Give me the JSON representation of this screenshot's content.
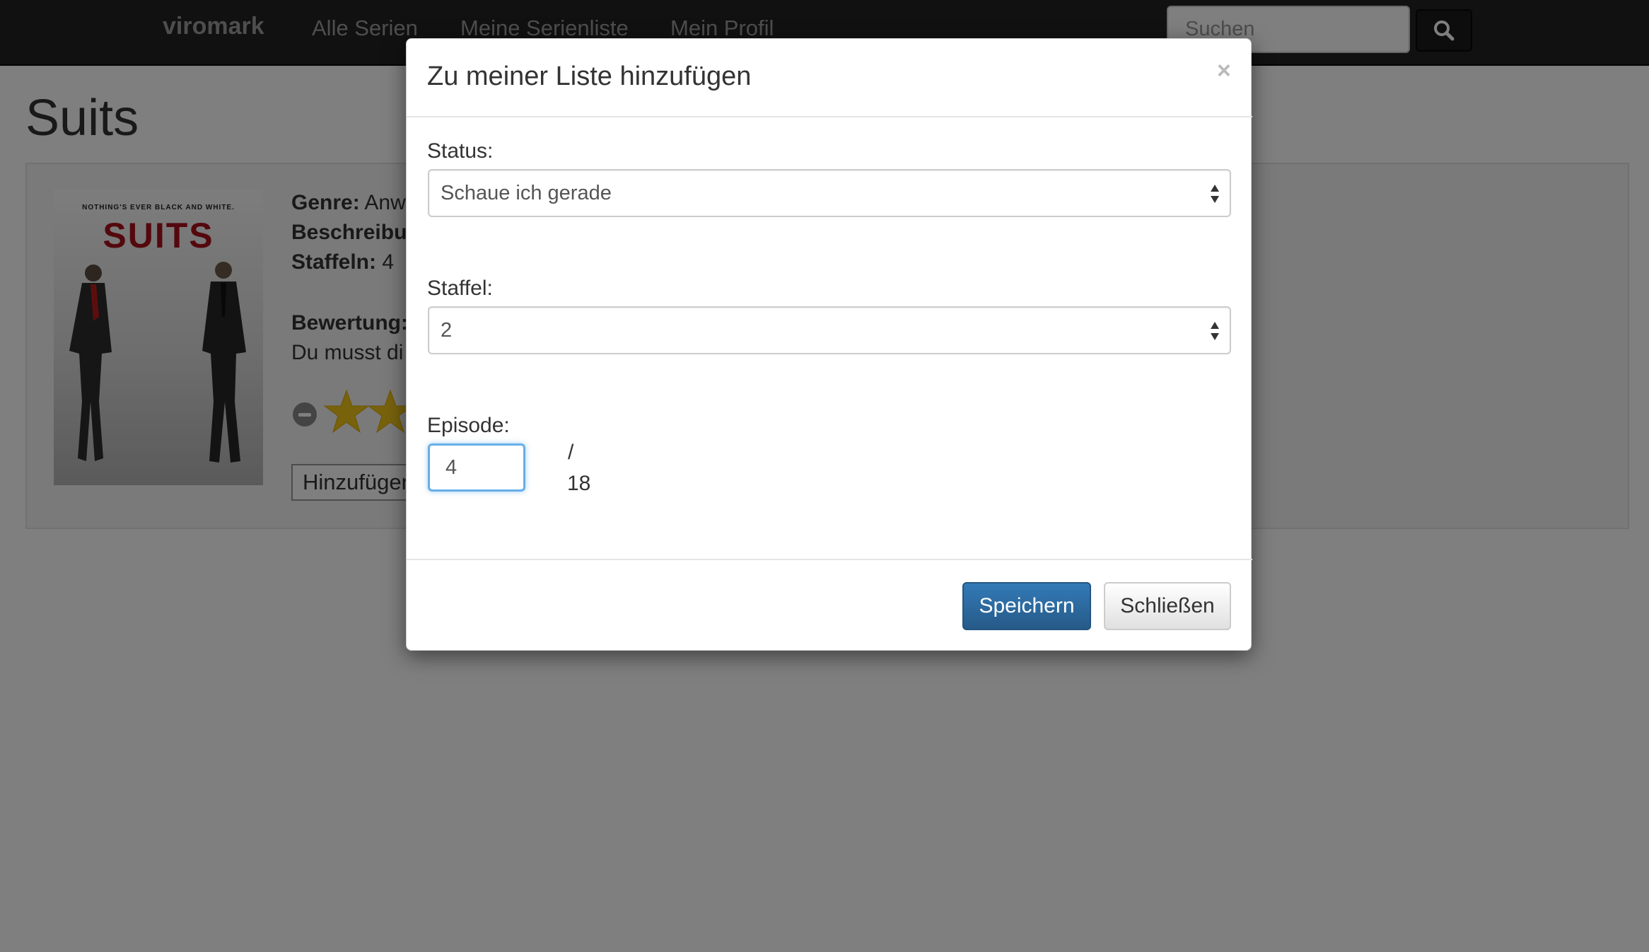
{
  "navbar": {
    "brand": "viromark",
    "links": [
      "Alle Serien",
      "Meine Serienliste",
      "Mein Profil"
    ],
    "search_placeholder": "Suchen",
    "search_icon": "search-icon"
  },
  "page": {
    "title": "Suits",
    "poster": {
      "tagline": "NOTHING'S EVER BLACK AND WHITE.",
      "title": "SUITS"
    },
    "genre_label": "Genre:",
    "genre_value": "Anw",
    "description_label": "Beschreibu",
    "seasons_label": "Staffeln:",
    "seasons_value": "4",
    "rating_label": "Bewertung:",
    "rating_text": "Du musst di",
    "add_button": "Hinzufügen"
  },
  "modal": {
    "title": "Zu meiner Liste hinzufügen",
    "close_symbol": "×",
    "status_label": "Status:",
    "status_value": "Schaue ich gerade",
    "season_label": "Staffel:",
    "season_value": "2",
    "episode_label": "Episode:",
    "episode_value": "4",
    "episode_separator": "/",
    "episode_total": "18",
    "save_button": "Speichern",
    "close_button": "Schließen"
  },
  "colors": {
    "navbar_bg": "#222222",
    "primary": "#337ab7",
    "star": "#f0c419",
    "focus": "#66afe9"
  }
}
